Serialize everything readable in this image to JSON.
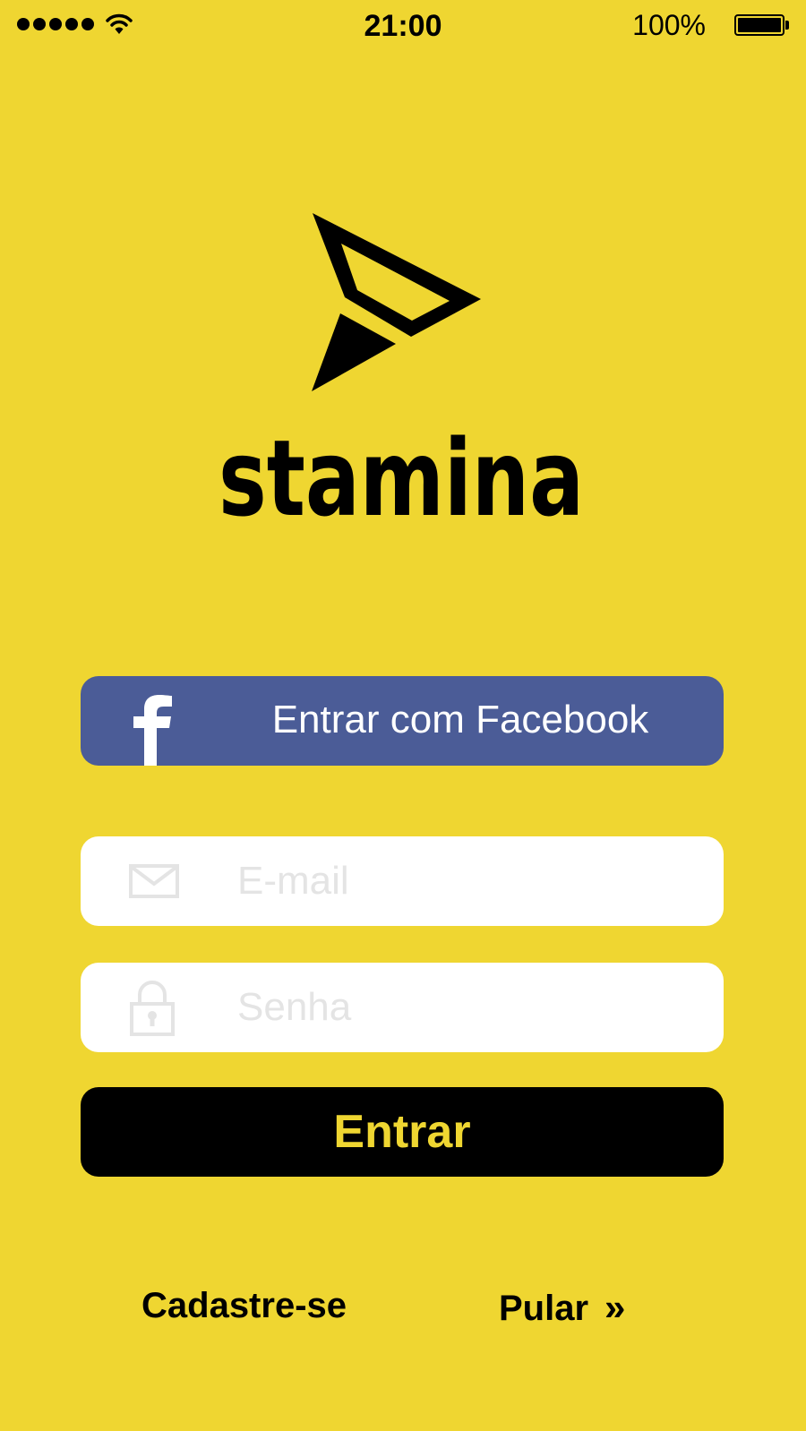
{
  "status_bar": {
    "time": "21:00",
    "battery_percent": "100%",
    "battery_level": 1.0,
    "signal_bars": 5,
    "icons": [
      "signal-dots-icon",
      "wifi-icon",
      "battery-icon"
    ]
  },
  "brand": {
    "logo_icon": "paper-plane-arrow-icon",
    "name": "stamina"
  },
  "facebook_button": {
    "icon": "facebook-f-icon",
    "label": "Entrar com Facebook"
  },
  "email_field": {
    "icon": "envelope-icon",
    "placeholder": "E-mail",
    "value": ""
  },
  "password_field": {
    "icon": "lock-icon",
    "placeholder": "Senha",
    "value": ""
  },
  "login_button": {
    "label": "Entrar"
  },
  "links": {
    "signup": "Cadastre-se",
    "skip": "Pular",
    "skip_icon": "double-chevron-right-icon",
    "skip_glyph": "»"
  },
  "colors": {
    "background": "#EFD631",
    "facebook": "#4B5C97",
    "primary_button": "#000000",
    "primary_button_text": "#EFD631",
    "field_background": "#FFFFFF",
    "placeholder": "#E4E4E4"
  }
}
